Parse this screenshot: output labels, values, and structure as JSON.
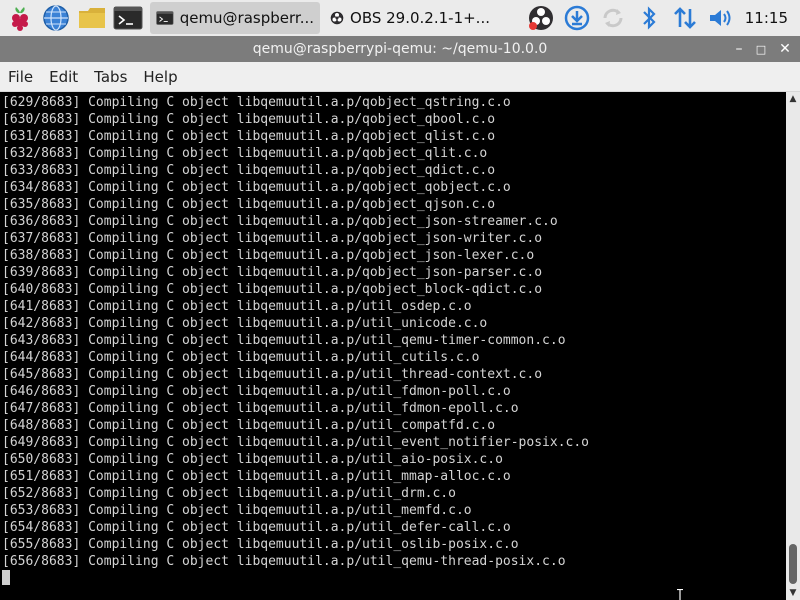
{
  "taskbar": {
    "tasks": [
      {
        "label": "qemu@raspberr..."
      },
      {
        "label": "OBS 29.0.2.1-1+..."
      }
    ],
    "clock": "11:15"
  },
  "window": {
    "title": "qemu@raspberrypi-qemu: ~/qemu-10.0.0",
    "minimize": "–",
    "maximize": "□",
    "close": "✕"
  },
  "menu": [
    "File",
    "Edit",
    "Tabs",
    "Help"
  ],
  "terminal": {
    "lines": [
      "[629/8683] Compiling C object libqemuutil.a.p/qobject_qstring.c.o",
      "[630/8683] Compiling C object libqemuutil.a.p/qobject_qbool.c.o",
      "[631/8683] Compiling C object libqemuutil.a.p/qobject_qlist.c.o",
      "[632/8683] Compiling C object libqemuutil.a.p/qobject_qlit.c.o",
      "[633/8683] Compiling C object libqemuutil.a.p/qobject_qdict.c.o",
      "[634/8683] Compiling C object libqemuutil.a.p/qobject_qobject.c.o",
      "[635/8683] Compiling C object libqemuutil.a.p/qobject_qjson.c.o",
      "[636/8683] Compiling C object libqemuutil.a.p/qobject_json-streamer.c.o",
      "[637/8683] Compiling C object libqemuutil.a.p/qobject_json-writer.c.o",
      "[638/8683] Compiling C object libqemuutil.a.p/qobject_json-lexer.c.o",
      "[639/8683] Compiling C object libqemuutil.a.p/qobject_json-parser.c.o",
      "[640/8683] Compiling C object libqemuutil.a.p/qobject_block-qdict.c.o",
      "[641/8683] Compiling C object libqemuutil.a.p/util_osdep.c.o",
      "[642/8683] Compiling C object libqemuutil.a.p/util_unicode.c.o",
      "[643/8683] Compiling C object libqemuutil.a.p/util_qemu-timer-common.c.o",
      "[644/8683] Compiling C object libqemuutil.a.p/util_cutils.c.o",
      "[645/8683] Compiling C object libqemuutil.a.p/util_thread-context.c.o",
      "[646/8683] Compiling C object libqemuutil.a.p/util_fdmon-poll.c.o",
      "[647/8683] Compiling C object libqemuutil.a.p/util_fdmon-epoll.c.o",
      "[648/8683] Compiling C object libqemuutil.a.p/util_compatfd.c.o",
      "[649/8683] Compiling C object libqemuutil.a.p/util_event_notifier-posix.c.o",
      "[650/8683] Compiling C object libqemuutil.a.p/util_aio-posix.c.o",
      "[651/8683] Compiling C object libqemuutil.a.p/util_mmap-alloc.c.o",
      "[652/8683] Compiling C object libqemuutil.a.p/util_drm.c.o",
      "[653/8683] Compiling C object libqemuutil.a.p/util_memfd.c.o",
      "[654/8683] Compiling C object libqemuutil.a.p/util_defer-call.c.o",
      "[655/8683] Compiling C object libqemuutil.a.p/util_oslib-posix.c.o",
      "[656/8683] Compiling C object libqemuutil.a.p/util_qemu-thread-posix.c.o"
    ]
  },
  "colors": {
    "taskbar_bg": "#ebebeb",
    "titlebar_bg": "#7c7c7c",
    "terminal_bg": "#000000",
    "terminal_fg": "#d4d4d4",
    "raspberry": "#c51a4a",
    "folder": "#e8c44a",
    "accent_blue": "#2b7bd6"
  }
}
